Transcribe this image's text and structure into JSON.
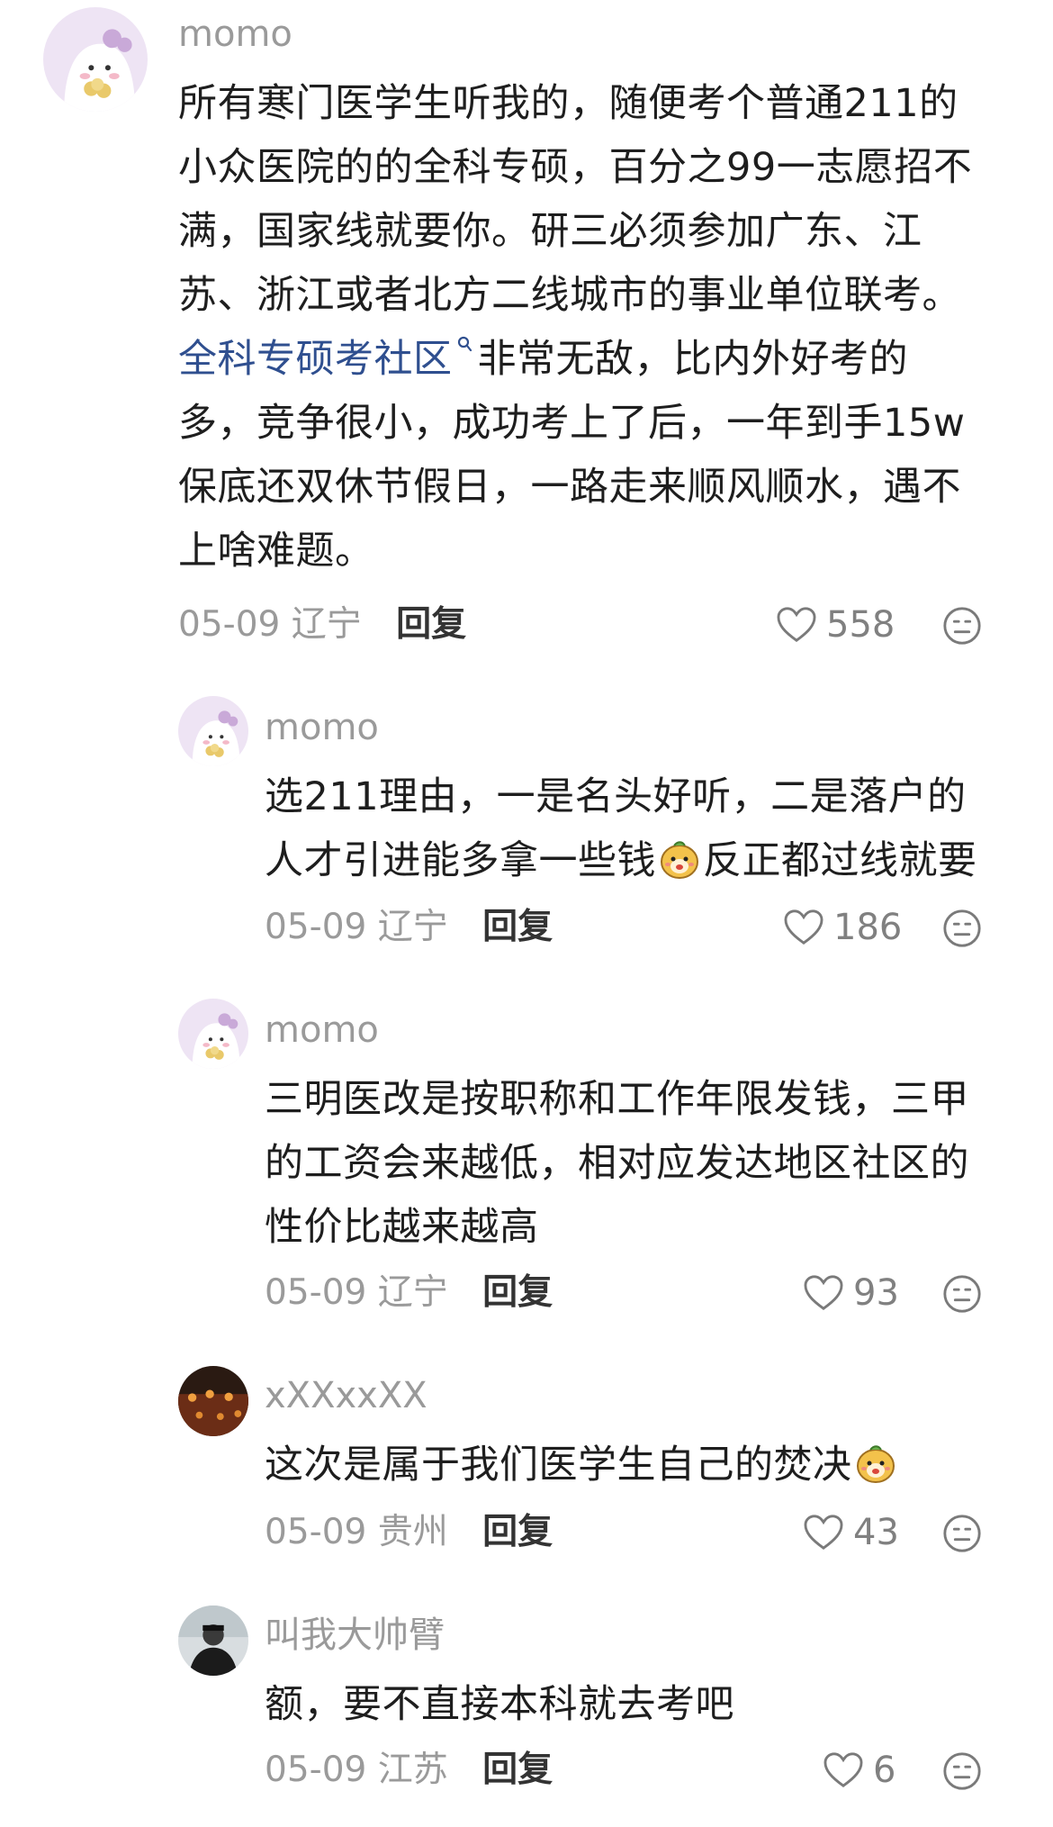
{
  "comments": [
    {
      "username": "momo",
      "lines": [
        "所有寒门医学生听我的，随便考个普通211的",
        "小众医院的的全科专硕，百分之99一志愿招不",
        "满，国家线就要你。研三必须参加广东、江",
        "苏、浙江或者北方二线城市的事业单位联考。"
      ],
      "link_text": "全科专硕考社区",
      "line5_rest": "非常无敌，比内外好考的",
      "lines_after": [
        "多，竞争很小，成功考上了后，一年到手15w",
        "保底还双休节假日，一路走来顺风顺水，遇不",
        "上啥难题。"
      ],
      "date": "05-09",
      "location": "辽宁",
      "reply": "回复",
      "likes": "558"
    },
    {
      "username": "momo",
      "line1": "选211理由，一是名头好听，二是落户的",
      "line2_a": "人才引进能多拿一些钱",
      "line2_b": "反正都过线就要",
      "date": "05-09",
      "location": "辽宁",
      "reply": "回复",
      "likes": "186"
    },
    {
      "username": "momo",
      "lines": [
        "三明医改是按职称和工作年限发钱，三甲",
        "的工资会来越低，相对应发达地区社区的",
        "性价比越来越高"
      ],
      "date": "05-09",
      "location": "辽宁",
      "reply": "回复",
      "likes": "93"
    },
    {
      "username": "xXXxxXX",
      "text": "这次是属于我们医学生自己的焚决",
      "date": "05-09",
      "location": "贵州",
      "reply": "回复",
      "likes": "43"
    },
    {
      "username": "叫我大帅臂",
      "text": "额，要不直接本科就去考吧",
      "date": "05-09",
      "location": "江苏",
      "reply": "回复",
      "likes": "6"
    }
  ],
  "icons": {
    "like": "heart-outline-icon",
    "dislike": "meh-face-icon",
    "search": "search-icon",
    "emoji": "cute-face-emoji"
  },
  "colors": {
    "link": "#2f4f8f",
    "meta": "#9a9a9a",
    "text": "#1e1e1e"
  }
}
